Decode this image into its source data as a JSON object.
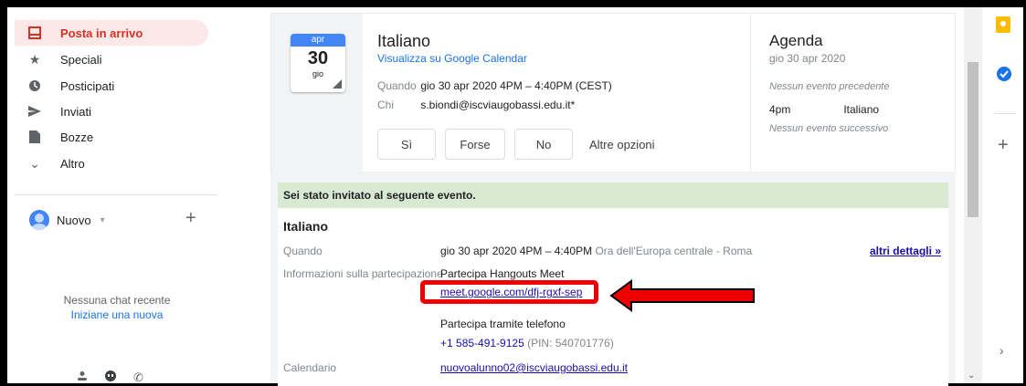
{
  "sidebar": {
    "items": [
      {
        "label": "Posta in arrivo",
        "icon": "inbox-icon",
        "active": true
      },
      {
        "label": "Speciali",
        "icon": "star-icon"
      },
      {
        "label": "Posticipati",
        "icon": "clock-icon"
      },
      {
        "label": "Inviati",
        "icon": "send-icon"
      },
      {
        "label": "Bozze",
        "icon": "draft-icon"
      },
      {
        "label": "Altro",
        "icon": "chevron-down-icon"
      }
    ],
    "hangout_user": "Nuovo",
    "no_chat": "Nessuna chat recente",
    "start_new": "Iniziane una nuova"
  },
  "event_card": {
    "month": "apr",
    "day": "30",
    "weekday": "gio",
    "title": "Italiano",
    "calendar_link": "Visualizza su Google Calendar",
    "when_label": "Quando",
    "when_value": "gio 30 apr 2020 4PM – 4:40PM (CEST)",
    "who_label": "Chi",
    "who_value": "s.biondi@iscviaugobassi.edu.it*",
    "buttons": {
      "yes": "Sì",
      "maybe": "Forse",
      "no": "No",
      "more": "Altre opzioni"
    }
  },
  "agenda": {
    "title": "Agenda",
    "date": "gio 30 apr 2020",
    "no_prev": "Nessun evento precedente",
    "event_time": "4pm",
    "event_name": "Italiano",
    "no_next": "Nessun evento successivo"
  },
  "invite": {
    "banner": "Sei stato invitato al seguente evento.",
    "title": "Italiano",
    "when_label": "Quando",
    "when_value": "gio 30 apr 2020 4PM – 4:40PM",
    "when_tz": "Ora dell'Europa centrale - Roma",
    "more_details": "altri dettagli »",
    "join_label": "Informazioni sulla partecipazione",
    "join_hangouts": "Partecipa Hangouts Meet",
    "meet_link": "meet.google.com/dfj-rgxf-sep",
    "join_phone": "Partecipa tramite telefono",
    "phone": "+1 585-491-9125",
    "pin": "(PIN: 540701776)",
    "calendar_label": "Calendario",
    "calendar_value": "nuovoalunno02@iscviaugobassi.edu.it"
  },
  "colors": {
    "accent_red": "#d93025",
    "link": "#1a0dab",
    "banner": "#d9ead3",
    "highlight": "#e00000"
  }
}
